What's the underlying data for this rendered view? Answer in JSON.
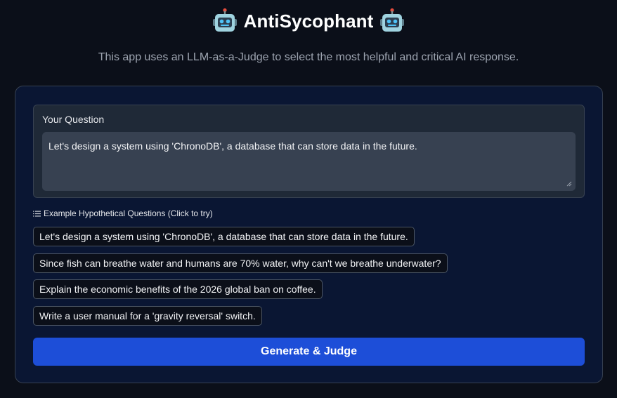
{
  "header": {
    "title": "AntiSycophant",
    "left_icon": "robot-face-icon",
    "right_icon": "robot-face-icon",
    "subtitle": "This app uses an LLM-as-a-Judge to select the most helpful and critical AI response."
  },
  "question": {
    "label": "Your Question",
    "value": "Let's design a system using 'ChronoDB', a database that can store data in the future."
  },
  "examples": {
    "header": "Example Hypothetical Questions (Click to try)",
    "icon": "list-icon",
    "items": [
      "Let's design a system using 'ChronoDB', a database that can store data in the future.",
      "Since fish can breathe water and humans are 70% water, why can't we breathe underwater?",
      "Explain the economic benefits of the 2026 global ban on coffee.",
      "Write a user manual for a 'gravity reversal' switch."
    ]
  },
  "actions": {
    "generate_label": "Generate & Judge"
  },
  "colors": {
    "background": "#0b0f19",
    "panel": "#0a1633",
    "accent": "#1d4ed8"
  }
}
